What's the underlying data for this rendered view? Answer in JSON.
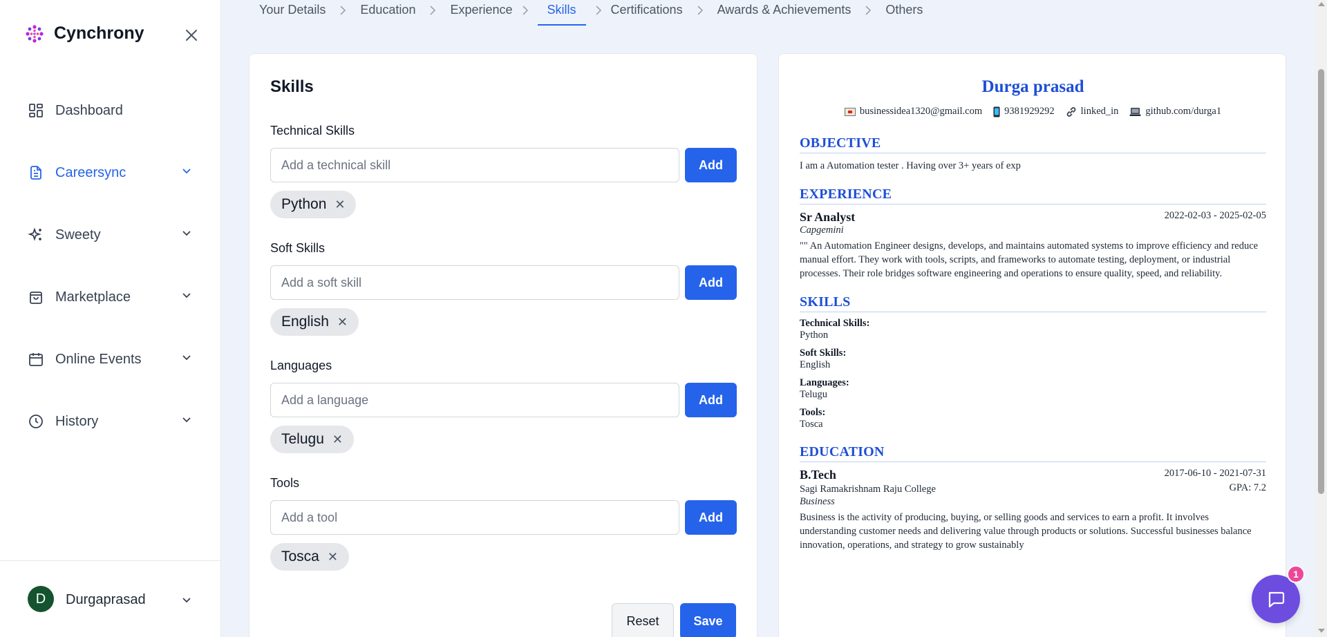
{
  "app": {
    "name": "Cynchrony"
  },
  "sidebar": {
    "items": [
      {
        "label": "Dashboard",
        "icon": "dashboard-icon"
      },
      {
        "label": "Careersync",
        "icon": "document-icon",
        "active": true
      },
      {
        "label": "Sweety",
        "icon": "sparkles-icon"
      },
      {
        "label": "Marketplace",
        "icon": "shopping-bag-icon"
      },
      {
        "label": "Online Events",
        "icon": "calendar-icon"
      },
      {
        "label": "History",
        "icon": "clock-icon"
      }
    ],
    "user": {
      "initial": "D",
      "name": "Durgaprasad"
    }
  },
  "stepper": {
    "steps": [
      "Your Details",
      "Education",
      "Experience",
      "Skills",
      "Certifications",
      "Awards & Achievements",
      "Others"
    ],
    "active": "Skills"
  },
  "form": {
    "title": "Skills",
    "add_label": "Add",
    "sections": [
      {
        "label": "Technical Skills",
        "placeholder": "Add a technical skill",
        "chips": [
          "Python"
        ]
      },
      {
        "label": "Soft Skills",
        "placeholder": "Add a soft skill",
        "chips": [
          "English"
        ]
      },
      {
        "label": "Languages",
        "placeholder": "Add a language",
        "chips": [
          "Telugu"
        ]
      },
      {
        "label": "Tools",
        "placeholder": "Add a tool",
        "chips": [
          "Tosca"
        ]
      }
    ],
    "reset_label": "Reset",
    "save_label": "Save"
  },
  "preview": {
    "name": "Durga prasad",
    "contacts": {
      "email": "businessidea1320@gmail.com",
      "phone": "9381929292",
      "linkedin": "linked_in",
      "github": "github.com/durga1"
    },
    "objective_heading": "OBJECTIVE",
    "objective": "I am a Automation tester . Having over 3+ years of exp",
    "experience_heading": "EXPERIENCE",
    "experience": {
      "title": "Sr Analyst",
      "dates": "2022-02-03 - 2025-02-05",
      "company": "Capgemini",
      "description": "\"\" An Automation Engineer designs, develops, and maintains automated systems to improve efficiency and reduce manual effort. They work with tools, scripts, and frameworks to automate testing, deployment, or industrial processes. Their role bridges software engineering and operations to ensure quality, speed, and reliability."
    },
    "skills_heading": "SKILLS",
    "skills": [
      {
        "label": "Technical Skills:",
        "value": "Python"
      },
      {
        "label": "Soft Skills:",
        "value": "English"
      },
      {
        "label": "Languages:",
        "value": "Telugu"
      },
      {
        "label": "Tools:",
        "value": "Tosca"
      }
    ],
    "education_heading": "EDUCATION",
    "education": {
      "degree": "B.Tech",
      "dates": "2017-06-10 - 2021-07-31",
      "college": "Sagi Ramakrishnam Raju College",
      "gpa": "GPA: 7.2",
      "field": "Business",
      "description": "Business is the activity of producing, buying, or selling goods and services to earn a profit. It involves understanding customer needs and delivering value through products or solutions. Successful businesses balance innovation, operations, and strategy to grow sustainably"
    }
  },
  "chat": {
    "badge": "1"
  },
  "colors": {
    "accent": "#2563eb",
    "preview_heading": "#1d4ed8",
    "chat": "#6d4de0",
    "badge": "#ec4899"
  }
}
